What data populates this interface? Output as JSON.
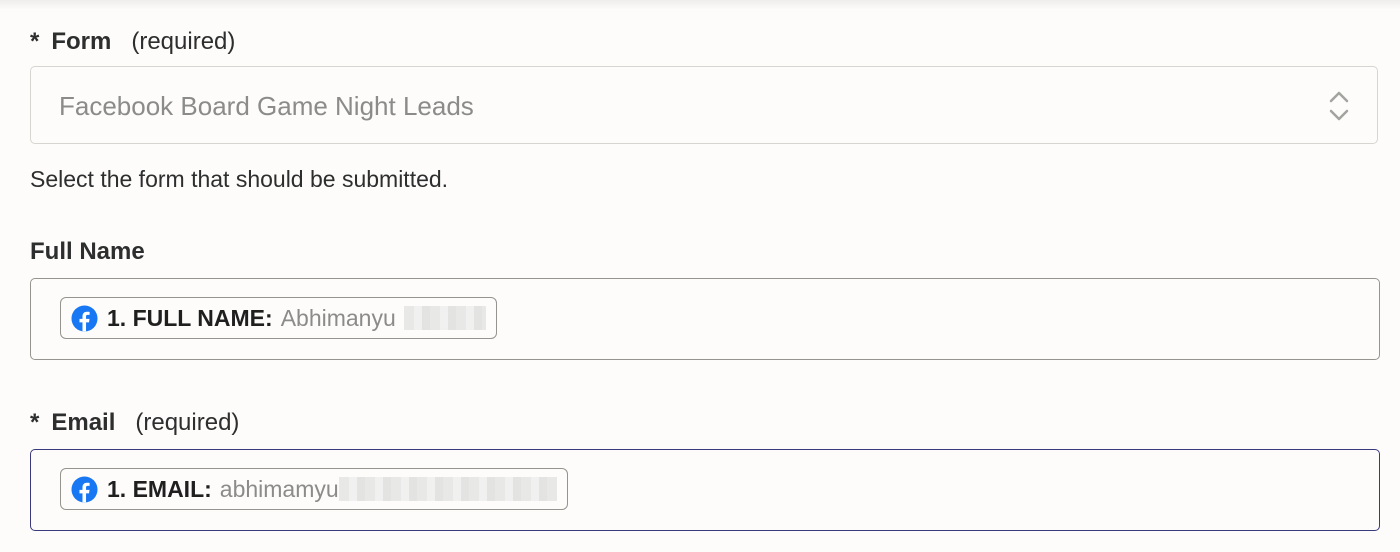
{
  "form_field": {
    "required_marker": "*",
    "label": "Form",
    "required_note": "(required)",
    "selected_value": "Facebook Board Game Night Leads",
    "help_text": "Select the form that should be submitted."
  },
  "full_name_field": {
    "label": "Full Name",
    "pill": {
      "icon": "facebook-icon",
      "key": "1. FULL NAME:",
      "value": "Abhimanyu"
    }
  },
  "email_field": {
    "required_marker": "*",
    "label": "Email",
    "required_note": "(required)",
    "pill": {
      "icon": "facebook-icon",
      "key": "1. EMAIL:",
      "value": "abhimamyu"
    }
  },
  "colors": {
    "facebook_blue": "#1877f2",
    "focus_border": "#3b3a7c",
    "placeholder_gray": "#8b8b8a"
  }
}
